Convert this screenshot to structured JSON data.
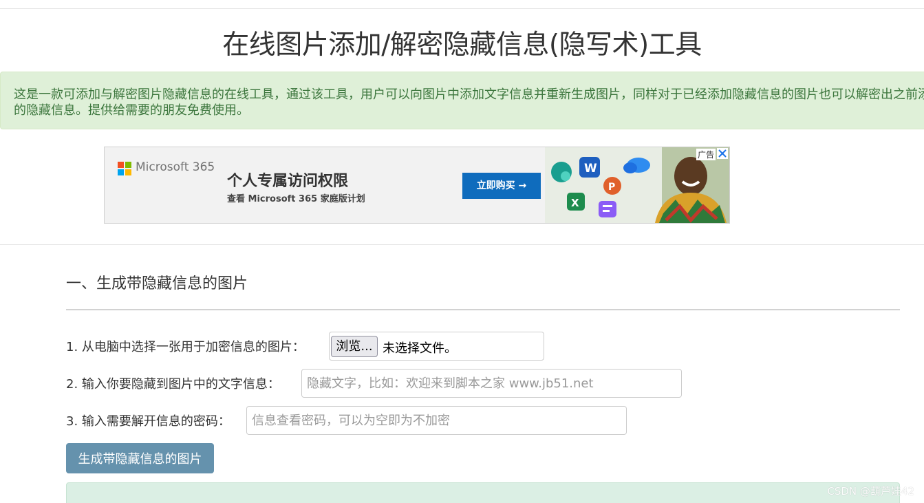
{
  "page": {
    "title": "在线图片添加/解密隐藏信息(隐写术)工具",
    "intro": "这是一款可添加与解密图片隐藏信息的在线工具，通过该工具，用户可以向图片中添加文字信息并重新生成图片，同样对于已经添加隐藏信息的图片也可以解密出之前添加的隐藏信息。提供给需要的朋友免费使用。"
  },
  "ad": {
    "brand": "Microsoft 365",
    "headline": "个人专属访问权限",
    "subline": "查看 Microsoft 365 家庭版计划",
    "cta": "立即购买 →",
    "label": "广告",
    "colors": {
      "logo_red": "#f25022",
      "logo_green": "#7fba00",
      "logo_blue": "#00a4ef",
      "logo_yellow": "#ffb900",
      "cta": "#0f6cbd"
    },
    "icons": [
      "loop-icon",
      "word-icon",
      "powerpoint-icon",
      "onedrive-icon",
      "excel-icon",
      "forms-icon",
      "person-photo"
    ]
  },
  "section1": {
    "heading": "一、生成带隐藏信息的图片",
    "step1_label": "1. 从电脑中选择一张用于加密信息的图片：",
    "browse_label": "浏览...",
    "file_status": "未选择文件。",
    "step2_label": "2. 输入你要隐藏到图片中的文字信息：",
    "step2_placeholder": "隐藏文字，比如：欢迎来到脚本之家 www.jb51.net",
    "step3_label": "3. 输入需要解开信息的密码：",
    "step3_placeholder": "信息查看密码，可以为空即为不加密",
    "generate_label": "生成带隐藏信息的图片"
  },
  "watermark": "CSDN @葫芦娃42",
  "colors": {
    "intro_bg": "#dff0d8",
    "intro_text": "#3c763d",
    "button_bg": "#6592ad",
    "result_bg": "#dbefe4"
  }
}
